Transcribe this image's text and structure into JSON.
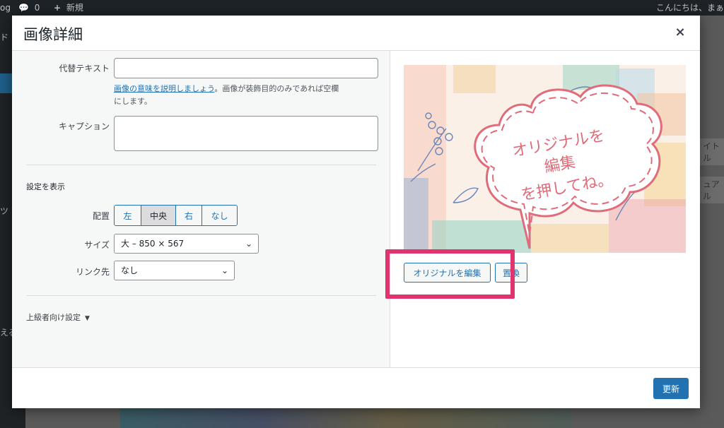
{
  "adminbar": {
    "site_fragment": "og",
    "comments_count": "0",
    "new_label": "新規",
    "greeting": "こんにちは、まぁ"
  },
  "background": {
    "left_fragments": [
      "ド",
      "ツ",
      "える"
    ],
    "right_fragments": [
      "イトル",
      "ュアル"
    ]
  },
  "modal": {
    "title": "画像詳細",
    "close_label": "×",
    "alt_text": {
      "label": "代替テキスト",
      "value": "",
      "help_link": "画像の意味を説明しましょう",
      "help_rest_line1": "。画像が装飾目的のみであれば空欄",
      "help_rest_line2": "にします。"
    },
    "caption": {
      "label": "キャプション",
      "value": ""
    },
    "display_settings": {
      "title": "設定を表示",
      "align_label": "配置",
      "align_options": [
        "左",
        "中央",
        "右",
        "なし"
      ],
      "align_selected": "中央",
      "size_label": "サイズ",
      "size_value": "大 – 850 × 567",
      "link_label": "リンク先",
      "link_value": "なし"
    },
    "advanced_label": "上級者向け設定",
    "preview": {
      "callout_line1": "オリジナルを",
      "callout_line2": "編集",
      "callout_line3": "を押してね。"
    },
    "edit_original_label": "オリジナルを編集",
    "replace_label": "置換",
    "update_label": "更新"
  },
  "colors": {
    "accent": "#2271b1",
    "highlight": "#e0336f",
    "callout": "#e06c7a"
  }
}
